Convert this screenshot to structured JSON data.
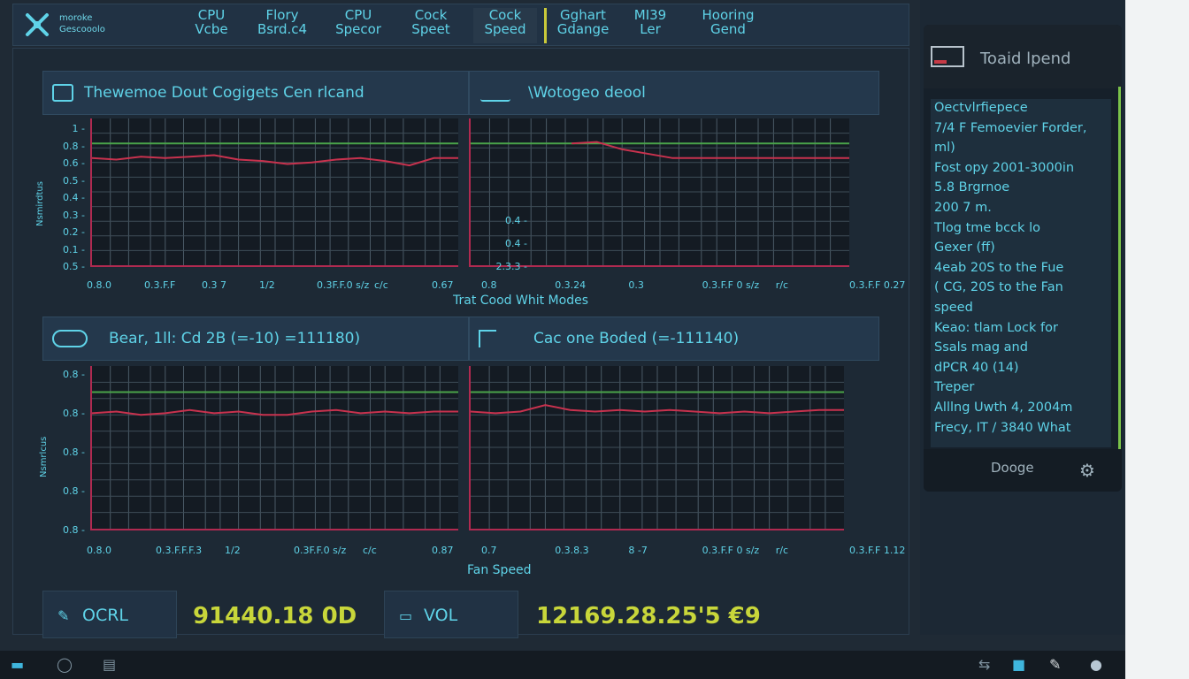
{
  "brand": {
    "line1": "moroke",
    "line2": "Gescooolo"
  },
  "tabs": [
    {
      "l1": "CPU",
      "l2": "Vcbe"
    },
    {
      "l1": "Flory",
      "l2": "Bsrd.c4"
    },
    {
      "l1": "CPU",
      "l2": "Specor"
    },
    {
      "l1": "Cock",
      "l2": "Speet"
    },
    {
      "l1": "Cock",
      "l2": "Speed"
    },
    {
      "l1": "Gghart",
      "l2": "Gdange"
    },
    {
      "l1": "MI39",
      "l2": "Ler"
    },
    {
      "l1": "Hooring",
      "l2": "Gend"
    }
  ],
  "active_tab": 4,
  "charts": [
    {
      "title": "Thewemoe Dout Cogigets Cen rlcand",
      "ylabels": [
        "1",
        "0.8",
        "0.6",
        "0.5",
        "0.4",
        "0.3",
        "0.2",
        "0.1",
        "0.5"
      ],
      "yaxis": "Nsmirdtus",
      "xlabels": [
        "0.8.0",
        "0.3.F.F",
        "0.3 7",
        "1/2",
        "0.3F.F.0 s/z",
        "c/c",
        "0.67"
      ],
      "ref": 0.83,
      "values": [
        0.73,
        0.72,
        0.74,
        0.73,
        0.74,
        0.75,
        0.72,
        0.71,
        0.69,
        0.7,
        0.72,
        0.73,
        0.71,
        0.68,
        0.73,
        0.73
      ]
    },
    {
      "title": "\\Wotogeo deool",
      "ylabels": [
        "0.4",
        "0.4",
        "2.3.3"
      ],
      "yaxis": "",
      "xlabels": [
        "0.8",
        "0.3.24",
        "0.3",
        "0.3.F.F 0 s/z",
        "r/c",
        "0.3.F.F 0.27"
      ],
      "ref": 0.83,
      "values": [
        null,
        null,
        null,
        null,
        0.83,
        0.84,
        0.79,
        0.76,
        0.73,
        0.73,
        0.73,
        0.73,
        0.73,
        0.73,
        0.73,
        0.73
      ]
    },
    {
      "title": "Bear, 1ll: Cd 2B (=-10) =111180)",
      "ylabels": [
        "0.8",
        "0.8",
        "0.8",
        "0.8",
        "0.8"
      ],
      "yaxis": "Nsmrlcus",
      "xlabels": [
        "0.8.0",
        "0.3.F.F.F.3",
        "1/2",
        "0.3F.F.0 s/z",
        "c/c",
        "0.87"
      ],
      "ref": 0.84,
      "values": [
        0.71,
        0.72,
        0.7,
        0.71,
        0.73,
        0.71,
        0.72,
        0.7,
        0.7,
        0.72,
        0.73,
        0.71,
        0.72,
        0.71,
        0.72,
        0.72
      ]
    },
    {
      "title": "Cac one Boded (=-111140)",
      "ylabels": [],
      "yaxis": "",
      "xlabels": [
        "0.7",
        "0.3.8.3",
        "8 -7",
        "0.3.F.F 0 s/z",
        "r/c",
        "0.3.F.F 1.12"
      ],
      "ref": 0.84,
      "values": [
        0.72,
        0.71,
        0.72,
        0.76,
        0.73,
        0.72,
        0.73,
        0.72,
        0.73,
        0.72,
        0.71,
        0.72,
        0.71,
        0.72,
        0.73,
        0.73
      ]
    }
  ],
  "axis_titles": {
    "top": "Trat Cood Whit Modes",
    "bottom": "Fan Speed"
  },
  "readouts": [
    {
      "label": "OCRL",
      "value": "91440.18 0D"
    },
    {
      "label": "VOL",
      "value": "12169.28.25'5 €9"
    }
  ],
  "side": {
    "title": "Toaid lpend",
    "lines": [
      "Oectvlrfiepece",
      "7/4 F Femoevier Forder,",
      "ml)",
      "Fost opy 2001-3000in",
      "5.8 Brgrnoe",
      "200 7 m.",
      "Tlog tme bcck lo",
      "Gexer (ff)",
      "4eab 20S to the Fue",
      "( CG, 20S to the Fan",
      "speed",
      "Keao: tlam Lock for",
      "Ssals mag and",
      "dPCR 40 (14)",
      "Treper",
      "Alllng Uwth 4, 2004m",
      "Frecy, IT / 3840 What"
    ],
    "button": "Dooge"
  },
  "colors": {
    "accent": "#5fd3e8",
    "ref_line": "#4aa34a",
    "series": "#c8324e",
    "value": "#c8d63a"
  }
}
